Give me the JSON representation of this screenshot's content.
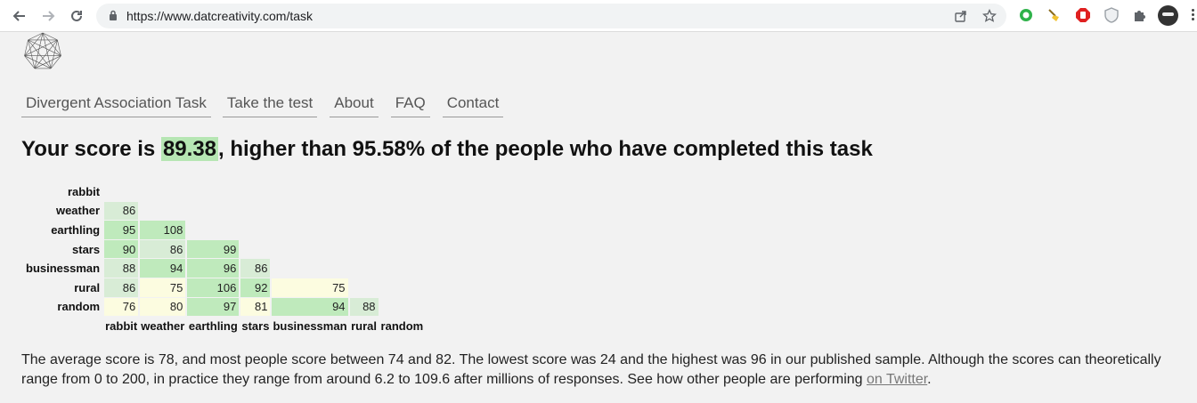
{
  "browser": {
    "url": "https://www.datcreativity.com/task",
    "nav_icons": [
      "back-arrow-icon",
      "forward-arrow-icon",
      "reload-icon"
    ],
    "extensions": [
      "green-circle-extension-icon",
      "broom-extension-icon",
      "red-stop-extension-icon",
      "shield-extension-icon",
      "puzzle-extensions-icon"
    ]
  },
  "nav": {
    "items": [
      "Divergent Association Task",
      "Take the test",
      "About",
      "FAQ",
      "Contact"
    ]
  },
  "score": {
    "prefix": "Your score is ",
    "value": "89.38",
    "suffix": ", higher than 95.58% of the people who have completed this task"
  },
  "matrix": {
    "words": [
      "rabbit",
      "weather",
      "earthling",
      "stars",
      "businessman",
      "rural",
      "random"
    ],
    "rows": [
      [],
      [
        86
      ],
      [
        95,
        108
      ],
      [
        90,
        86,
        99
      ],
      [
        88,
        94,
        96,
        86
      ],
      [
        86,
        75,
        106,
        92,
        75
      ],
      [
        76,
        80,
        97,
        81,
        94,
        88
      ]
    ],
    "colors": {
      "low": "#fcfce0",
      "mid": "#d8ecd6",
      "high": "#bfeabc"
    }
  },
  "description": {
    "text": "The average score is 78, and most people score between 74 and 82. The lowest score was 24 and the highest was 96 in our published sample. Although the scores can theoretically range from 0 to 200, in practice they range from around 6.2 to 109.6 after millions of responses. See how other people are performing ",
    "link": "on Twitter",
    "end": "."
  }
}
